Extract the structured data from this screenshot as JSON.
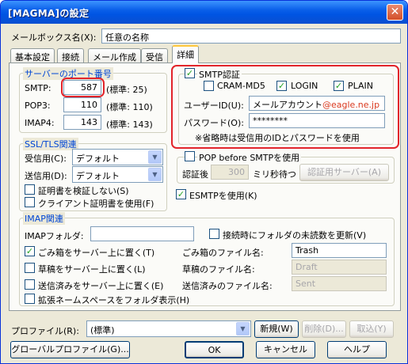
{
  "window": {
    "title": "[MAGMA]の設定",
    "close": "✕"
  },
  "mailbox": {
    "label": "メールボックス名(X):",
    "value": "任意の名称"
  },
  "tabs": [
    "基本設定",
    "接続",
    "メール作成",
    "受信",
    "詳細"
  ],
  "ports": {
    "legend": "サーバーのポート番号",
    "smtp_label": "SMTP:",
    "smtp_value": "587",
    "smtp_default": "(標準: 25)",
    "pop3_label": "POP3:",
    "pop3_value": "110",
    "pop3_default": "(標準: 110)",
    "imap4_label": "IMAP4:",
    "imap4_value": "143",
    "imap4_default": "(標準: 143)"
  },
  "ssl": {
    "legend": "SSL/TLS関連",
    "recv_label": "受信用(C):",
    "recv_value": "デフォルト",
    "send_label": "送信用(D):",
    "send_value": "デフォルト",
    "verify": "証明書を検証しない(S)",
    "client_cert": "クライアント証明書を使用(F)"
  },
  "smtp_auth": {
    "label": "SMTP認証",
    "cram": "CRAM-MD5",
    "login": "LOGIN",
    "plain": "PLAIN",
    "user_label": "ユーザーID(U):",
    "user_value": "メールアカウント",
    "user_domain": "@eagle.ne.jp",
    "pass_label": "パスワード(O):",
    "pass_value": "********",
    "note": "※省略時は受信用のIDとパスワードを使用"
  },
  "pop_before": {
    "label": "POP before SMTPを使用",
    "wait_label": "認証後",
    "wait_value": "300",
    "wait_unit": "ミリ秒待つ",
    "server_btn": "認証用サーバー(A)"
  },
  "esmtp": {
    "label": "ESMTPを使用(K)"
  },
  "imap": {
    "legend": "IMAP関連",
    "folder_label": "IMAPフォルダ:",
    "folder_value": "",
    "unread": "接続時にフォルダの未読数を更新(V)",
    "trash_chk": "ごみ箱をサーバー上に置く(T)",
    "trash_name_label": "ごみ箱のファイル名:",
    "trash_name_value": "Trash",
    "draft_chk": "草稿をサーバー上に置く(L)",
    "draft_name_label": "草稿のファイル名:",
    "draft_name_value": "Draft",
    "sent_chk": "送信済みをサーバー上に置く(E)",
    "sent_name_label": "送信済みのファイル名:",
    "sent_name_value": "Sent",
    "ext_ns": "拡張ネームスペースをフォルダ表示(H)"
  },
  "profile": {
    "label": "プロファイル(R):",
    "value": "(標準)",
    "new_btn": "新規(W)",
    "del_btn": "削除(D)...",
    "cancel_btn": "取込(Y)"
  },
  "footer": {
    "global_btn": "グローバルプロファイル(G)...",
    "ok_btn": "OK",
    "cancel_btn": "キャンセル",
    "help_btn": "ヘルプ"
  },
  "colors": {
    "red_highlight": "#e2242b",
    "domain_text": "#d9381e",
    "legend_blue": "#0046d5"
  }
}
